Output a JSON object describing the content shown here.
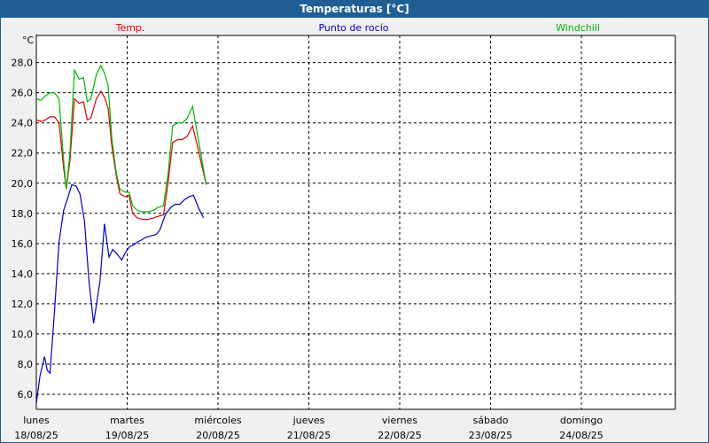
{
  "window": {
    "title": "Temperaturas [°C]"
  },
  "chart_data": {
    "type": "line",
    "title": "Temperaturas [°C]",
    "ylabel": "°C",
    "ylim": [
      5.0,
      29.0
    ],
    "y_ticks": [
      "6,0",
      "8,0",
      "10,0",
      "12,0",
      "14,0",
      "16,0",
      "18,0",
      "20,0",
      "22,0",
      "24,0",
      "26,0",
      "28,0"
    ],
    "x_ticks": [
      {
        "day": "lunes",
        "date": "18/08/25"
      },
      {
        "day": "martes",
        "date": "19/08/25"
      },
      {
        "day": "miércoles",
        "date": "20/08/25"
      },
      {
        "day": "jueves",
        "date": "21/08/25"
      },
      {
        "day": "viernes",
        "date": "22/08/25"
      },
      {
        "day": "sábado",
        "date": "23/08/25"
      },
      {
        "day": "domingo",
        "date": "24/08/25"
      }
    ],
    "xlim_days": [
      0,
      7
    ],
    "grid": true,
    "legend_position": "top",
    "series": [
      {
        "name": "Temp.",
        "color": "#e00000",
        "points": [
          [
            0.0,
            24.2
          ],
          [
            0.05,
            24.1
          ],
          [
            0.1,
            24.2
          ],
          [
            0.15,
            24.4
          ],
          [
            0.2,
            24.4
          ],
          [
            0.25,
            24.0
          ],
          [
            0.3,
            21.0
          ],
          [
            0.33,
            19.6
          ],
          [
            0.37,
            21.5
          ],
          [
            0.42,
            25.6
          ],
          [
            0.47,
            25.3
          ],
          [
            0.52,
            25.4
          ],
          [
            0.56,
            24.2
          ],
          [
            0.6,
            24.3
          ],
          [
            0.66,
            25.6
          ],
          [
            0.71,
            26.1
          ],
          [
            0.75,
            25.7
          ],
          [
            0.79,
            25.0
          ],
          [
            0.83,
            22.5
          ],
          [
            0.88,
            20.5
          ],
          [
            0.92,
            19.3
          ],
          [
            0.98,
            19.1
          ],
          [
            1.02,
            19.2
          ],
          [
            1.06,
            18.0
          ],
          [
            1.11,
            17.7
          ],
          [
            1.17,
            17.6
          ],
          [
            1.23,
            17.6
          ],
          [
            1.29,
            17.7
          ],
          [
            1.34,
            17.8
          ],
          [
            1.4,
            17.9
          ],
          [
            1.45,
            20.0
          ],
          [
            1.5,
            22.7
          ],
          [
            1.56,
            22.9
          ],
          [
            1.61,
            22.9
          ],
          [
            1.66,
            23.1
          ],
          [
            1.72,
            23.8
          ],
          [
            1.76,
            22.8
          ],
          [
            1.82,
            21.2
          ],
          [
            1.87,
            19.9
          ]
        ]
      },
      {
        "name": "Punto de rocío",
        "color": "#0000c8",
        "points": [
          [
            0.0,
            5.4
          ],
          [
            0.04,
            7.2
          ],
          [
            0.09,
            8.5
          ],
          [
            0.12,
            7.6
          ],
          [
            0.15,
            7.4
          ],
          [
            0.2,
            11.5
          ],
          [
            0.25,
            16.1
          ],
          [
            0.3,
            18.2
          ],
          [
            0.35,
            19.1
          ],
          [
            0.39,
            19.9
          ],
          [
            0.44,
            19.8
          ],
          [
            0.48,
            19.3
          ],
          [
            0.53,
            17.5
          ],
          [
            0.58,
            13.5
          ],
          [
            0.63,
            10.7
          ],
          [
            0.7,
            13.5
          ],
          [
            0.75,
            17.3
          ],
          [
            0.8,
            15.1
          ],
          [
            0.84,
            15.6
          ],
          [
            0.89,
            15.3
          ],
          [
            0.94,
            14.9
          ],
          [
            0.99,
            15.5
          ],
          [
            1.03,
            15.8
          ],
          [
            1.07,
            15.9
          ],
          [
            1.11,
            16.1
          ],
          [
            1.15,
            16.2
          ],
          [
            1.2,
            16.4
          ],
          [
            1.26,
            16.5
          ],
          [
            1.32,
            16.6
          ],
          [
            1.36,
            16.9
          ],
          [
            1.42,
            17.9
          ],
          [
            1.48,
            18.4
          ],
          [
            1.53,
            18.6
          ],
          [
            1.58,
            18.6
          ],
          [
            1.63,
            18.9
          ],
          [
            1.68,
            19.1
          ],
          [
            1.73,
            19.2
          ],
          [
            1.79,
            18.3
          ],
          [
            1.84,
            17.7
          ]
        ]
      },
      {
        "name": "Windchill",
        "color": "#00b400",
        "points": [
          [
            0.0,
            25.6
          ],
          [
            0.05,
            25.5
          ],
          [
            0.1,
            25.8
          ],
          [
            0.15,
            26.0
          ],
          [
            0.2,
            26.0
          ],
          [
            0.25,
            25.6
          ],
          [
            0.3,
            21.5
          ],
          [
            0.33,
            19.6
          ],
          [
            0.37,
            22.0
          ],
          [
            0.42,
            27.5
          ],
          [
            0.47,
            26.9
          ],
          [
            0.52,
            27.0
          ],
          [
            0.56,
            25.4
          ],
          [
            0.6,
            25.6
          ],
          [
            0.66,
            27.2
          ],
          [
            0.71,
            27.8
          ],
          [
            0.75,
            27.3
          ],
          [
            0.79,
            26.5
          ],
          [
            0.83,
            23.0
          ],
          [
            0.88,
            20.7
          ],
          [
            0.92,
            19.6
          ],
          [
            0.98,
            19.4
          ],
          [
            1.02,
            19.4
          ],
          [
            1.06,
            18.5
          ],
          [
            1.11,
            18.2
          ],
          [
            1.17,
            18.1
          ],
          [
            1.23,
            18.1
          ],
          [
            1.29,
            18.2
          ],
          [
            1.34,
            18.4
          ],
          [
            1.4,
            18.5
          ],
          [
            1.45,
            20.6
          ],
          [
            1.5,
            23.8
          ],
          [
            1.56,
            24.0
          ],
          [
            1.61,
            24.0
          ],
          [
            1.66,
            24.3
          ],
          [
            1.72,
            25.1
          ],
          [
            1.76,
            23.7
          ],
          [
            1.82,
            21.6
          ],
          [
            1.87,
            19.9
          ]
        ]
      }
    ]
  }
}
